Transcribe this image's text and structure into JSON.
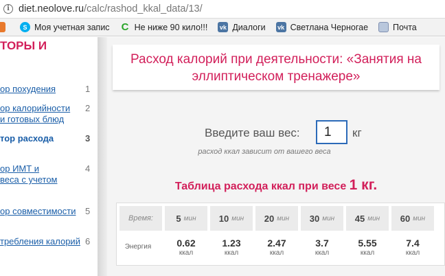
{
  "browser": {
    "url_host": "diet.neolove.ru",
    "url_path": "/calc/rashod_kkal_data/13/"
  },
  "bookmarks": [
    {
      "label": "Моя учетная запис",
      "icon": "skype-icon"
    },
    {
      "label": "Не ниже 90 кило!!!",
      "icon": "c-icon"
    },
    {
      "label": "Диалоги",
      "icon": "vk-icon"
    },
    {
      "label": "Светлана Черногае",
      "icon": "vk-icon"
    },
    {
      "label": "Почта",
      "icon": "mail-icon"
    }
  ],
  "sidebar": {
    "title": "ТОРЫ И",
    "items": [
      {
        "label": "ор похудения",
        "num": "1"
      },
      {
        "label": "ор калорийности",
        "label2": "и готовых блюд",
        "num": "2"
      },
      {
        "label": "тор расхода",
        "num": "3"
      },
      {
        "label": "ор ИМТ и",
        "label2": "веса с учетом",
        "num": "4"
      },
      {
        "label": "ор совместимости",
        "num": "5"
      },
      {
        "label": "требления калорий",
        "num": "6"
      }
    ]
  },
  "main": {
    "title": "Расход калорий при деятельности: «Занятия на эллиптическом тренажере»",
    "weight_label": "Введите ваш вес:",
    "weight_value": "1",
    "weight_unit": "кг",
    "hint": "расход ккал зависит от вашего веса",
    "table_title": "Таблица расхода ккал при весе",
    "table_title_weight": "1 кг.",
    "table": {
      "time_label": "Время:",
      "energy_label": "Энергия",
      "unit_min": "мин",
      "unit_kcal": "ккал",
      "columns": [
        {
          "minutes": "5",
          "kcal": "0.62"
        },
        {
          "minutes": "10",
          "kcal": "1.23"
        },
        {
          "minutes": "20",
          "kcal": "2.47"
        },
        {
          "minutes": "30",
          "kcal": "3.7"
        },
        {
          "minutes": "45",
          "kcal": "5.55"
        },
        {
          "minutes": "60",
          "kcal": "7.4"
        }
      ]
    }
  }
}
